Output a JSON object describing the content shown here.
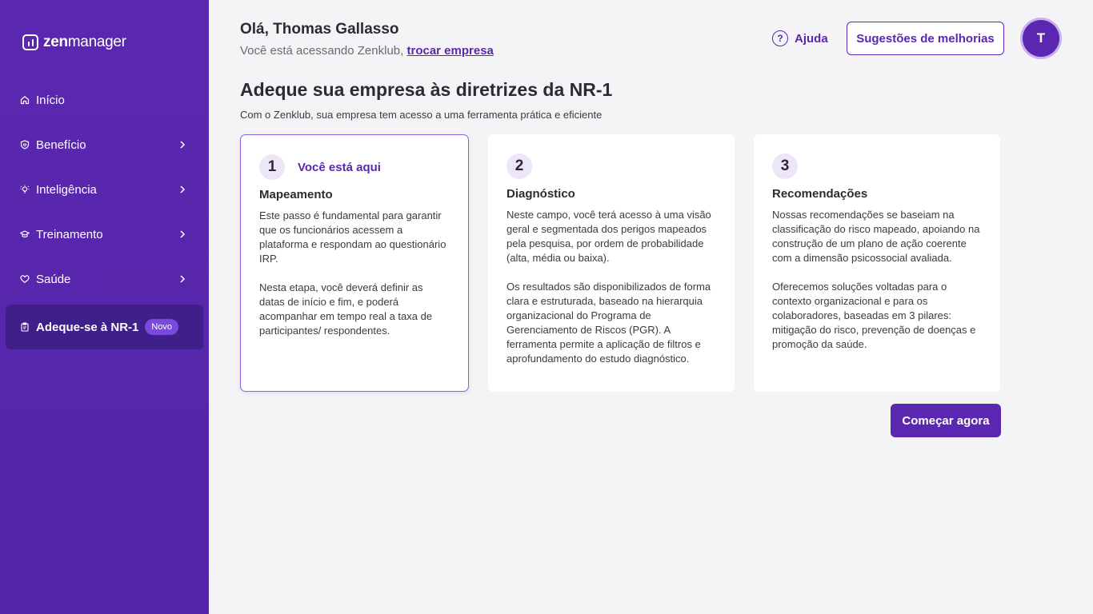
{
  "brand": {
    "logo_bold": "zen",
    "logo_light": "manager"
  },
  "sidebar": {
    "items": [
      {
        "label": "Início",
        "icon": "home-icon",
        "has_chevron": false
      },
      {
        "label": "Benefício",
        "icon": "shield-heart-icon",
        "has_chevron": true
      },
      {
        "label": "Inteligência",
        "icon": "lightbulb-icon",
        "has_chevron": true
      },
      {
        "label": "Treinamento",
        "icon": "graduation-cap-icon",
        "has_chevron": true
      },
      {
        "label": "Saúde",
        "icon": "heart-icon",
        "has_chevron": true
      },
      {
        "label": "Adeque-se à NR-1",
        "icon": "clipboard-icon",
        "badge": "Novo",
        "active": true
      }
    ]
  },
  "header": {
    "greeting": "Olá, Thomas Gallasso",
    "access_text": "Você está acessando Zenklub,",
    "switch_link": "trocar empresa",
    "help_label": "Ajuda",
    "suggest_label": "Sugestões de melhorias",
    "avatar_initial": "T"
  },
  "main": {
    "title": "Adeque sua empresa às diretrizes da NR-1",
    "subtitle": "Com o Zenklub, sua empresa tem acesso a uma ferramenta prática e eficiente",
    "cards": [
      {
        "number": "1",
        "here_label": "Você está aqui",
        "title": "Mapeamento",
        "p1": "Este passo é fundamental para garantir que os funcionários acessem a plataforma e respondam ao questionário IRP.",
        "p2": "Nesta etapa, você deverá definir as datas de início e fim, e poderá acompanhar em tempo real a taxa de participantes/ respondentes."
      },
      {
        "number": "2",
        "title": "Diagnóstico",
        "p1": "Neste campo, você terá acesso à uma visão geral e segmentada dos perigos mapeados pela pesquisa, por ordem de probabilidade (alta, média ou baixa).",
        "p2": "Os resultados são disponibilizados de forma clara e estruturada, baseado na hierarquia organizacional do Programa de Gerenciamento de Riscos (PGR). A ferramenta permite a aplicação de filtros e aprofundamento do estudo diagnóstico."
      },
      {
        "number": "3",
        "title": "Recomendações",
        "p1": "Nossas recomendações se baseiam na classificação do risco mapeado, apoiando na construção de um plano de ação coerente com a dimensão psicossocial avaliada.",
        "p2": "Oferecemos soluções voltadas para o contexto organizacional e para os colaboradores, baseadas em 3 pilares: mitigação do risco, prevenção de doenças e promoção da saúde."
      }
    ],
    "start_label": "Começar agora"
  },
  "colors": {
    "primary": "#5b27b0",
    "sidebar_active": "#3f1f8a",
    "badge": "#7a49dd"
  }
}
